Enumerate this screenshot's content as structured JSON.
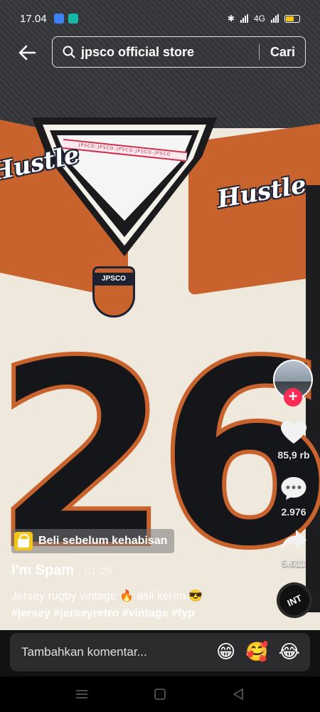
{
  "status_bar": {
    "time": "17.04",
    "network": "4G"
  },
  "search": {
    "query": "jpsco official store",
    "submit_label": "Cari"
  },
  "video": {
    "collar_tape_text": "JPSCO-JPSCO-JPSCO-JPSCO-JPSCO",
    "sleeve_text": "Hustle",
    "badge_text": "JPSCO",
    "jersey_number": "26"
  },
  "actions": {
    "likes": "85,9 rb",
    "comments": "2.976",
    "shares": "5.611",
    "music_disc_label": "INT"
  },
  "post": {
    "shop_banner": "Beli sebelum kehabisan",
    "author": "I'm Spam",
    "date": "· 01-29",
    "caption": "Jersey rugby vintage 🔥  asli keren 😎",
    "hashtags": "#jersey #jerseyretro #vintage #fyp"
  },
  "comment": {
    "placeholder": "Tambahkan komentar...",
    "emojis": [
      "😁",
      "🥰",
      "😂"
    ]
  },
  "colors": {
    "accent_follow": "#fe2c55",
    "jersey_orange": "#c8632d",
    "shop_yellow": "#f5c518"
  }
}
